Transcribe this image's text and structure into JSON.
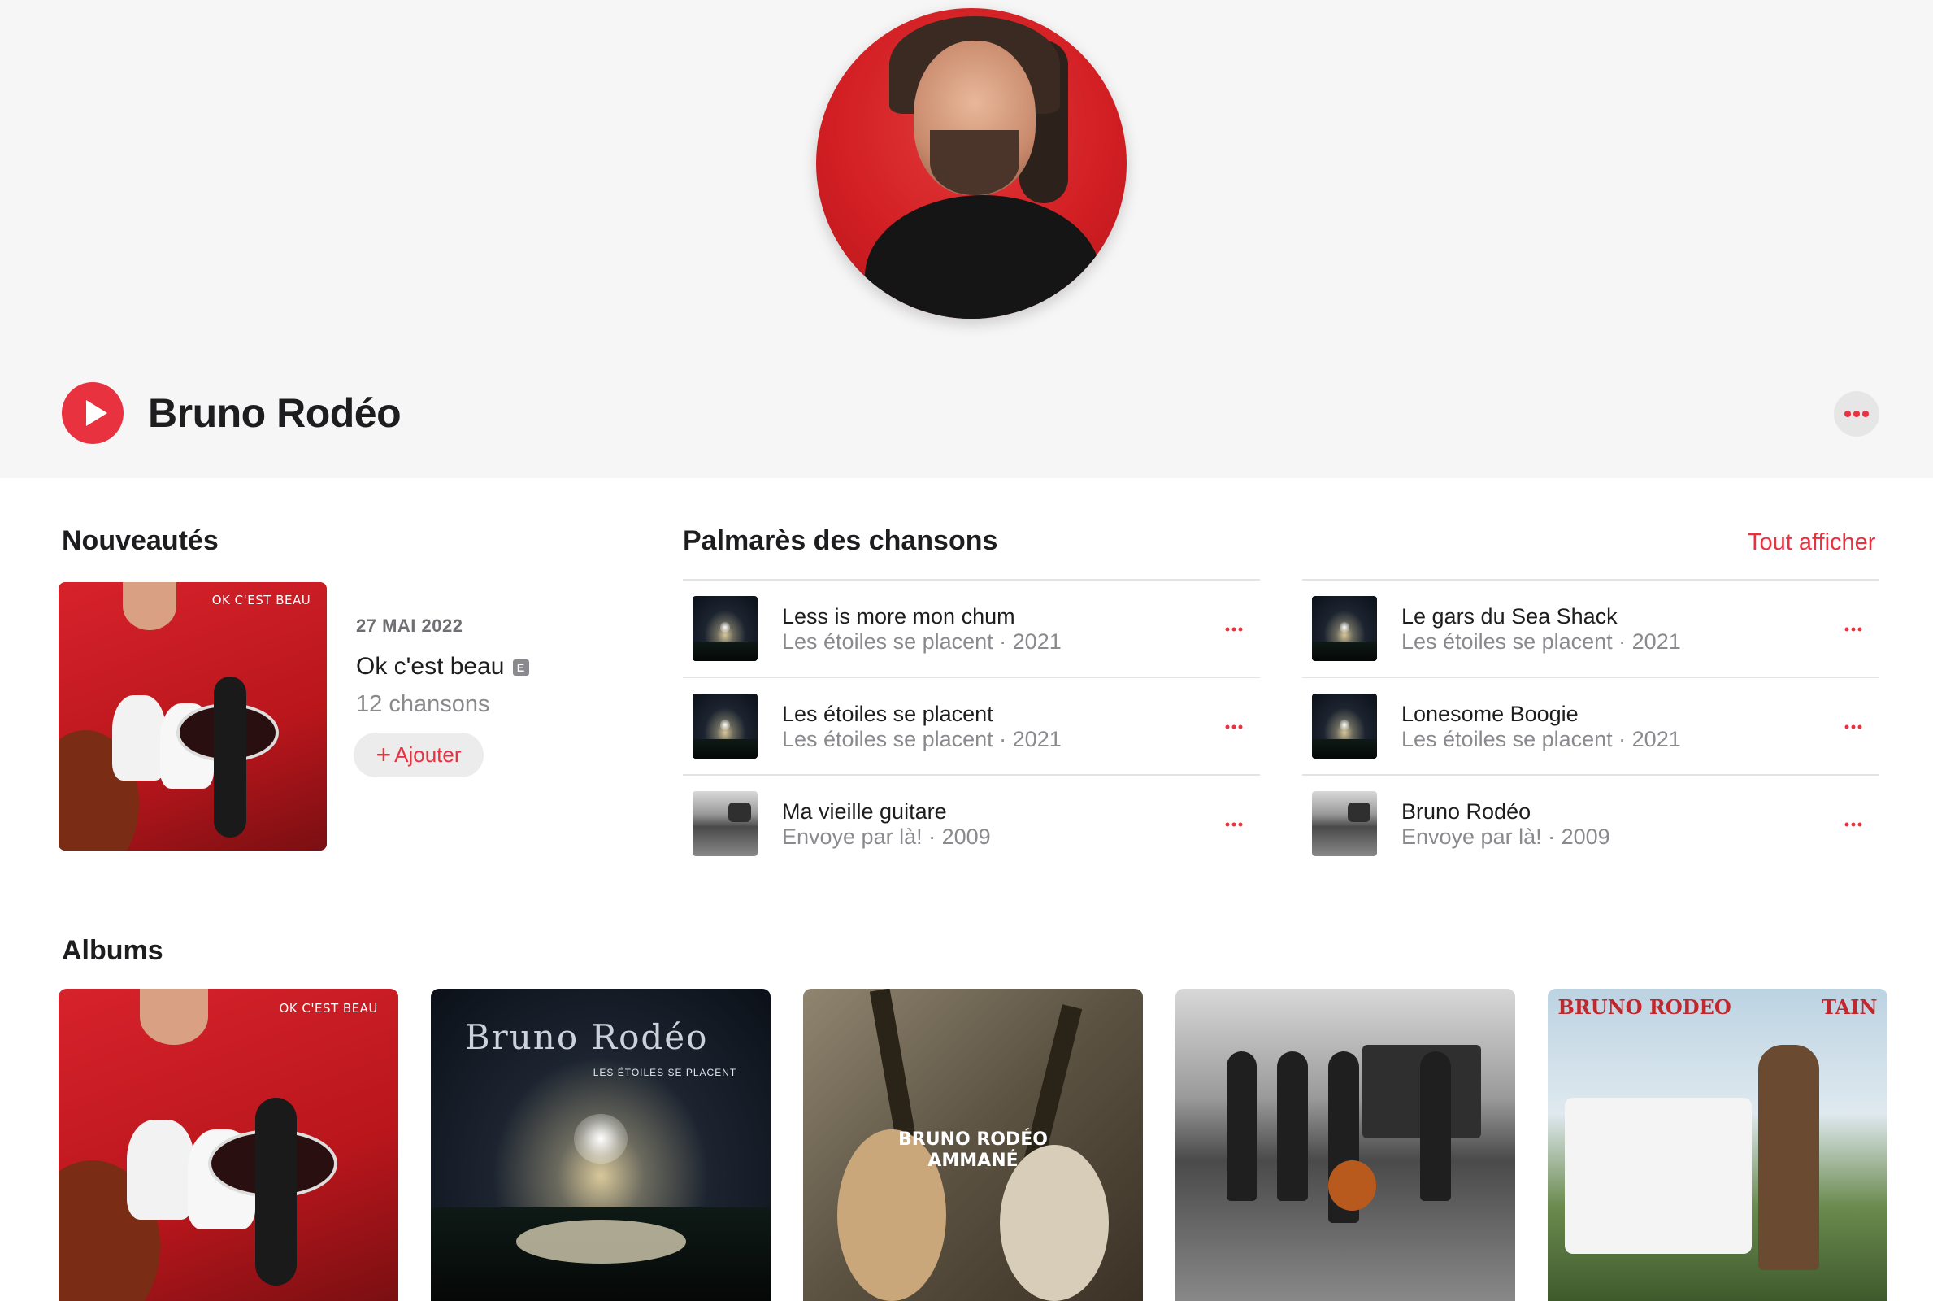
{
  "artist": {
    "name": "Bruno Rodéo"
  },
  "sections": {
    "latest_title": "Nouveautés",
    "top_songs_title": "Palmarès des chansons",
    "see_all": "Tout afficher",
    "albums_title": "Albums"
  },
  "latest_release": {
    "date": "27 MAI 2022",
    "title": "Ok c'est beau",
    "explicit": "E",
    "count": "12 chansons",
    "add_label": "Ajouter",
    "art_label": "OK C'EST BEAU"
  },
  "top_songs": [
    {
      "title": "Less is more mon chum",
      "subtitle": "Les étoiles se placent · 2021"
    },
    {
      "title": "Les étoiles se placent",
      "subtitle": "Les étoiles se placent · 2021"
    },
    {
      "title": "Ma vieille guitare",
      "subtitle": "Envoye par là! · 2009"
    },
    {
      "title": "Le gars du Sea Shack",
      "subtitle": "Les étoiles se placent · 2021"
    },
    {
      "title": "Lonesome Boogie",
      "subtitle": "Les étoiles se placent · 2021"
    },
    {
      "title": "Bruno Rodéo",
      "subtitle": "Envoye par là! · 2009"
    }
  ],
  "albums": [
    {
      "art_label": "OK C'EST BEAU"
    },
    {
      "art_label": "Bruno Rodéo",
      "art_sublabel": "LES ÉTOILES SE PLACENT"
    },
    {
      "art_label_1": "BRUNO RODÉO",
      "art_label_2": "AMMANÉ"
    },
    {},
    {
      "art_label_1": "BRUNO RODEO",
      "art_label_2": "TAIN"
    }
  ],
  "colors": {
    "accent": "#e9323f",
    "hero_bg": "#f6f6f6",
    "text_primary": "#1d1d1f",
    "text_secondary": "#8a8a8e"
  },
  "icons": {
    "play": "play-icon",
    "more": "ellipsis-icon",
    "explicit": "explicit-badge"
  }
}
